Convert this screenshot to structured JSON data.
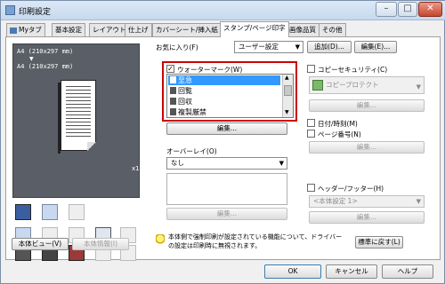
{
  "window": {
    "title": "印刷設定",
    "minimize": "–",
    "maximize": "□",
    "close": "✕"
  },
  "tabs": [
    {
      "label": "Myタブ"
    },
    {
      "label": "基本設定"
    },
    {
      "label": "レイアウト"
    },
    {
      "label": "仕上げ"
    },
    {
      "label": "カバーシート/挿入紙"
    },
    {
      "label": "スタンプ/ページ印字"
    },
    {
      "label": "画像品質"
    },
    {
      "label": "その他"
    }
  ],
  "active_tab": "スタンプ/ページ印字",
  "favorites": {
    "label": "お気に入り(F)",
    "value": "ユーザー設定",
    "add_button": "追加(D)...",
    "edit_button": "編集(E)..."
  },
  "preview": {
    "line1": "A4 (210x297 mm)",
    "arrow": "▼",
    "line2": "A4 (210x297 mm)",
    "copies": "x1"
  },
  "left_buttons": {
    "body_view": "本体ビュー(V)",
    "body_info": "本体情報(I)"
  },
  "watermark": {
    "label": "ウォーターマーク(W)",
    "checked": true,
    "items": [
      "至急",
      "回覧",
      "回収",
      "複製厳禁"
    ],
    "selected": "至急",
    "edit_button": "編集..."
  },
  "overlay": {
    "label": "オーバーレイ(O)",
    "value": "なし",
    "edit_button": "編集..."
  },
  "copy_security": {
    "label": "コピーセキュリティ(C)",
    "value": "コピープロテクト",
    "edit_button": "編集..."
  },
  "date_time": {
    "label": "日付/時刻(M)"
  },
  "page_number": {
    "label": "ページ番号(N)",
    "edit_button": "編集..."
  },
  "header_footer": {
    "label": "ヘッダー/フッター(H)",
    "value": "<本体設定 1>",
    "edit_button": "編集..."
  },
  "info_text": "本体側で強制印刷が設定されている機能について、ドライバーの設定は印刷時に無視されます。",
  "defaults_button": "標準に戻す(L)",
  "footer": {
    "ok": "OK",
    "cancel": "キャンセル",
    "help": "ヘルプ"
  },
  "colors": {
    "highlight": "#cc0000",
    "selection": "#3399ff"
  }
}
